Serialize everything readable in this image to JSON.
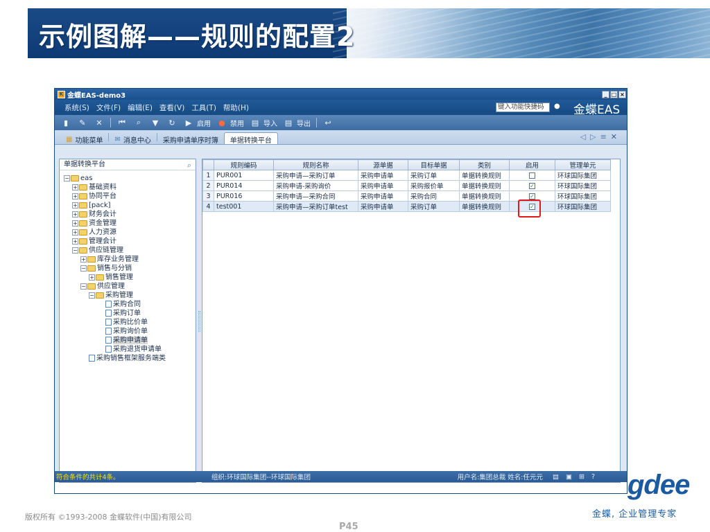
{
  "slide": {
    "title": "示例图解——规则的配置2",
    "copyright": "版权所有 ©1993-2008 金蝶软件(中国)有限公司",
    "page": "P45",
    "logo_text": "gdee",
    "slogan": "金蝶, 企业管理专家"
  },
  "window": {
    "title": "金蝶EAS-demo3",
    "brand": "金蝶EAS",
    "quick_search": "键入功能快捷码",
    "menus": [
      "系统(S)",
      "文件(F)",
      "编辑(E)",
      "查看(V)",
      "工具(T)",
      "帮助(H)"
    ],
    "toolbar": {
      "enable": "启用",
      "disable": "禁用",
      "import": "导入",
      "export": "导出"
    },
    "tabs": [
      "功能菜单",
      "消息中心",
      "采购申请单序时簿",
      "单据转换平台"
    ]
  },
  "tree": {
    "header": "单据转换平台",
    "nodes": [
      {
        "label": "eas"
      },
      {
        "label": "基础资料"
      },
      {
        "label": "协同平台"
      },
      {
        "label": "[pack]"
      },
      {
        "label": "财务会计"
      },
      {
        "label": "资金管理"
      },
      {
        "label": "人力资源"
      },
      {
        "label": "管理会计"
      },
      {
        "label": "供应链管理"
      },
      {
        "label": "库存业务管理"
      },
      {
        "label": "销售与分销"
      },
      {
        "label": "销售管理"
      },
      {
        "label": "供应管理"
      },
      {
        "label": "采购管理"
      },
      {
        "label": "采购合同"
      },
      {
        "label": "采购订单"
      },
      {
        "label": "采购比价单"
      },
      {
        "label": "采购询价单"
      },
      {
        "label": "采购申请单"
      },
      {
        "label": "采购退货申请单"
      },
      {
        "label": "采购销售框架服务端类"
      }
    ]
  },
  "grid": {
    "columns": [
      "规则编码",
      "规则名称",
      "源单据",
      "目标单据",
      "类别",
      "启用",
      "管理单元"
    ],
    "rows": [
      {
        "no": "1",
        "code": "PUR001",
        "name": "采购申请—采购订单",
        "source": "采购申请单",
        "target": "采购订单",
        "category": "单据转换规则",
        "enabled": false,
        "unit": "环球国际集团"
      },
      {
        "no": "2",
        "code": "PUR014",
        "name": "采购申请-采购询价",
        "source": "采购申请单",
        "target": "采购报价单",
        "category": "单据转换规则",
        "enabled": true,
        "unit": "环球国际集团"
      },
      {
        "no": "3",
        "code": "PUR016",
        "name": "采购申请—采购合同",
        "source": "采购申请单",
        "target": "采购合同",
        "category": "单据转换规则",
        "enabled": true,
        "unit": "环球国际集团"
      },
      {
        "no": "4",
        "code": "test001",
        "name": "采购申请—采购订单test",
        "source": "采购申请单",
        "target": "采购订单",
        "category": "单据转换规则",
        "enabled": true,
        "unit": "环球国际集团"
      }
    ]
  },
  "status": {
    "count": "符合条件的共计4条。",
    "org": "组织:环球国际集团--环球国际集团",
    "user": "用户名:集团总裁 姓名:任元元"
  }
}
